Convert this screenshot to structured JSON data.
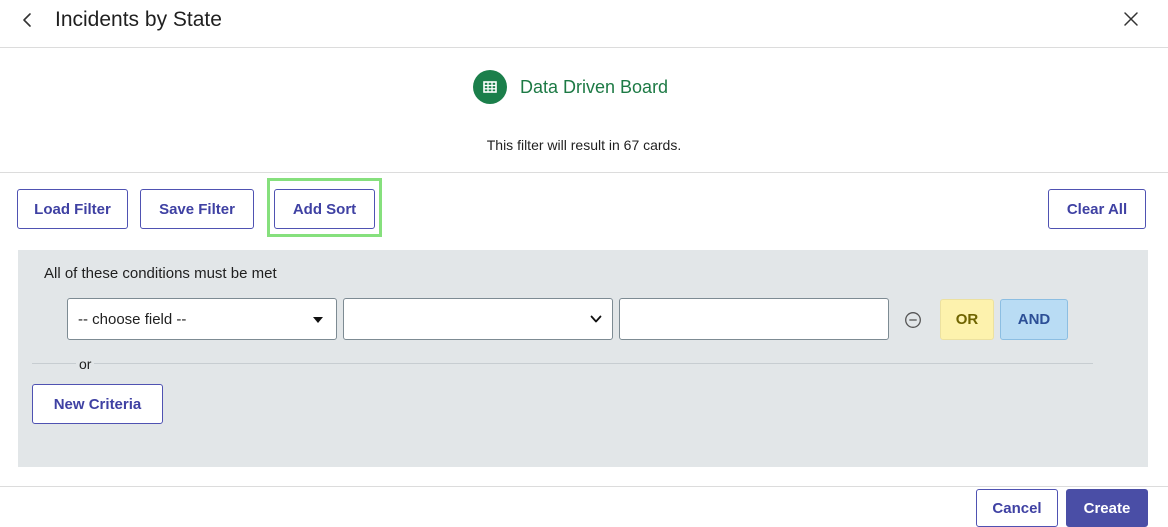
{
  "header": {
    "title": "Incidents by State",
    "back_icon": "chevron-left-icon",
    "close_icon": "close-icon"
  },
  "board": {
    "label": "Data Driven Board",
    "icon": "table-icon",
    "color": "#1b7f4b"
  },
  "summary": "This filter will result in 67 cards.",
  "toolbar": {
    "load_filter": "Load Filter",
    "save_filter": "Save Filter",
    "add_sort": "Add Sort",
    "clear_all": "Clear All"
  },
  "criteria": {
    "heading": "All of these conditions must be met",
    "field_select": "-- choose field --",
    "operator_select": "",
    "value_input": "",
    "remove_icon": "minus-circle-icon",
    "or_button": "OR",
    "and_button": "AND",
    "or_separator": "or",
    "new_criteria": "New Criteria"
  },
  "footer": {
    "cancel": "Cancel",
    "create": "Create"
  },
  "colors": {
    "accent": "#4a4ea6",
    "highlight": "#86e07d",
    "panel": "#e2e6e8"
  }
}
